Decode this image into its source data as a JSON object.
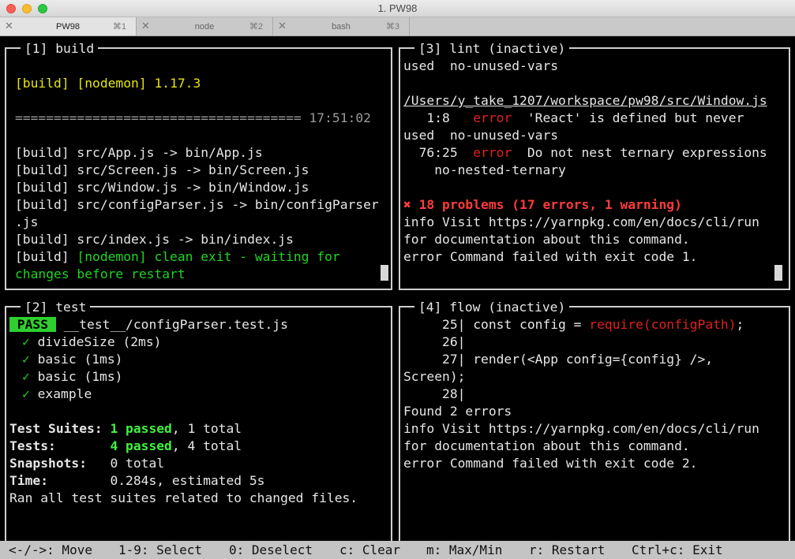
{
  "window": {
    "title": "1. PW98"
  },
  "tabs": [
    {
      "label": "PW98",
      "shortcut": "⌘1",
      "active": true
    },
    {
      "label": "node",
      "shortcut": "⌘2",
      "active": false
    },
    {
      "label": "bash",
      "shortcut": "⌘3",
      "active": false
    }
  ],
  "panes": {
    "build": {
      "title": "[1] build",
      "nodemon_prefix": "[build] ",
      "nodemon_tag": "[nodemon]",
      "nodemon_version": " 1.17.3",
      "separator": "=====================================",
      "time": "17:51:02",
      "files": [
        "[build] src/App.js -> bin/App.js",
        "[build] src/Screen.js -> bin/Screen.js",
        "[build] src/Window.js -> bin/Window.js",
        "[build] src/configParser.js -> bin/configParser",
        ".js",
        "[build] src/index.js -> bin/index.js"
      ],
      "exit_prefix": "[build] ",
      "exit_line1": "[nodemon] clean exit - waiting for",
      "exit_line2": "changes before restart"
    },
    "lint": {
      "title": "[3] lint (inactive)",
      "line1": "used  no-unused-vars",
      "file_path": "/Users/y_take_1207/workspace/pw98/src/Window.js",
      "err1_pos": "   1:8   ",
      "err1_level": "error",
      "err1_msg": "  'React' is defined but never",
      "err1_cont": "used  no-unused-vars",
      "err2_pos": "  76:25  ",
      "err2_level": "error",
      "err2_msg": "  Do not nest ternary expressions",
      "err2_cont": "    no-nested-ternary",
      "problems": "✖ 18 problems (17 errors, 1 warning)",
      "info1": "info Visit https://yarnpkg.com/en/docs/cli/run",
      "info2": "for documentation about this command.",
      "error_line": "error Command failed with exit code 1."
    },
    "test": {
      "title": "[2] test",
      "pass_badge": " PASS ",
      "test_file": " __test__/configParser.test.js",
      "tests": [
        {
          "mark": "✓",
          "name": "divideSize (2ms)"
        },
        {
          "mark": "✓",
          "name": "basic (1ms)"
        },
        {
          "mark": "✓",
          "name": "basic (1ms)"
        },
        {
          "mark": "✓",
          "name": "example"
        }
      ],
      "suites_label": "Test Suites: ",
      "suites_passed": "1 passed",
      "suites_total": ", 1 total",
      "tests_label": "Tests:       ",
      "tests_passed": "4 passed",
      "tests_total": ", 4 total",
      "snapshots_label": "Snapshots:   ",
      "snapshots_value": "0 total",
      "time_label": "Time:        ",
      "time_value": "0.284s, estimated 5s",
      "ran_all": "Ran all test suites related to changed files."
    },
    "flow": {
      "title": "[4] flow (inactive)",
      "code_line25_num": "     25| ",
      "code_line25_pre": "const config = ",
      "code_line25_req": "require(configPath)",
      "code_line25_post": ";",
      "code_line26": "     26|",
      "code_line27": "     27| render(<App config={config} />,",
      "code_line27_cont": "Screen);",
      "code_line28": "     28|",
      "found": "Found 2 errors",
      "info1": "info Visit https://yarnpkg.com/en/docs/cli/run",
      "info2": "for documentation about this command.",
      "error_line": "error Command failed with exit code 2."
    }
  },
  "statusbar": {
    "move": "<-/->: Move",
    "select": "1-9: Select",
    "deselect": "0: Deselect",
    "clear": "c: Clear",
    "maxmin": "m: Max/Min",
    "restart": "r: Restart",
    "exit": "Ctrl+c: Exit"
  },
  "colors": {
    "error_red": "#e0201f",
    "success_green": "#1fd51f",
    "nodemon_yellow": "#e5e510"
  }
}
